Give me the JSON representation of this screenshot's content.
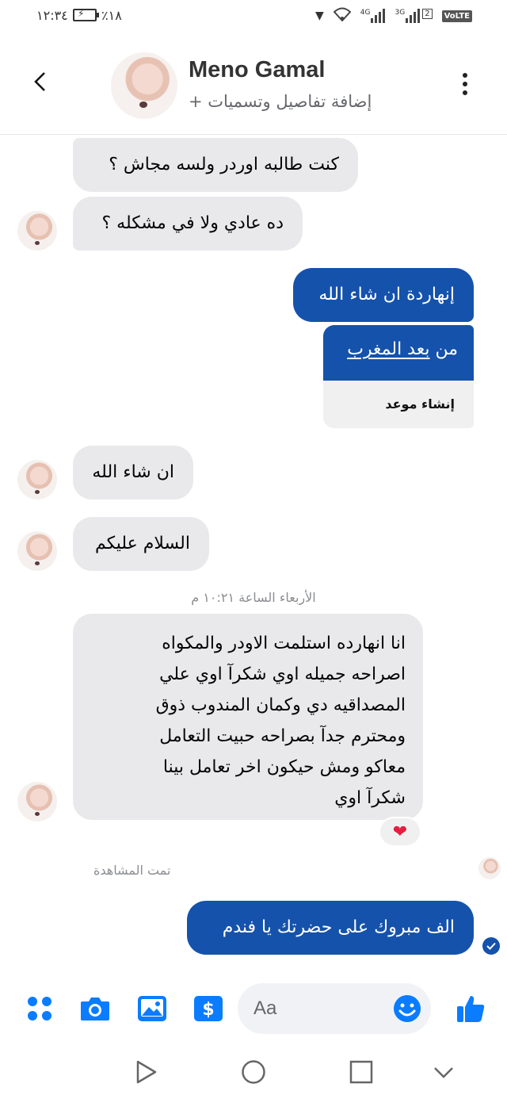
{
  "status_bar": {
    "time": "١٢:٣٤",
    "battery_percent": "٪١٨",
    "network_1": "4G",
    "network_2": "3G",
    "sim_badge": "2",
    "volte": "VoLTE"
  },
  "header": {
    "contact_name": "Meno Gamal",
    "subtitle": "+ إضافة تفاصيل وتسميات"
  },
  "messages": [
    {
      "direction": "incoming",
      "text": "كنت طالبه اوردر ولسه مجاش ؟"
    },
    {
      "direction": "incoming",
      "text": "ده عادي ولا في مشكله ؟"
    },
    {
      "direction": "outgoing",
      "text": "إنهاردة ان شاء الله"
    },
    {
      "direction": "outgoing",
      "text_prefix": "من ",
      "text_link": "بعد المغرب",
      "action": "إنشاء موعد"
    },
    {
      "direction": "incoming",
      "text": "ان شاء الله"
    },
    {
      "direction": "incoming",
      "text": "السلام عليكم"
    },
    {
      "direction": "incoming",
      "lines": [
        "انا انهارده استلمت الاودر والمكواه",
        "اصراحه جميله اوي شكرآ اوي علي",
        "المصداقيه دي وكمان المندوب ذوق",
        "ومحترم جدآ بصراحه حبيت التعامل",
        "معاكو ومش حيكون اخر تعامل بينا",
        "شكرآ اوي"
      ],
      "reaction": "❤"
    },
    {
      "direction": "outgoing",
      "text": "الف مبروك على حضرتك يا فندم"
    }
  ],
  "timestamp": "الأربعاء الساعة ١٠:٢١ م",
  "seen_label": "تمت المشاهدة",
  "composer": {
    "placeholder": "Aa"
  },
  "colors": {
    "accent": "#1552ab",
    "icon_blue": "#0a7cff",
    "incoming_bubble": "#e9e9eb"
  }
}
